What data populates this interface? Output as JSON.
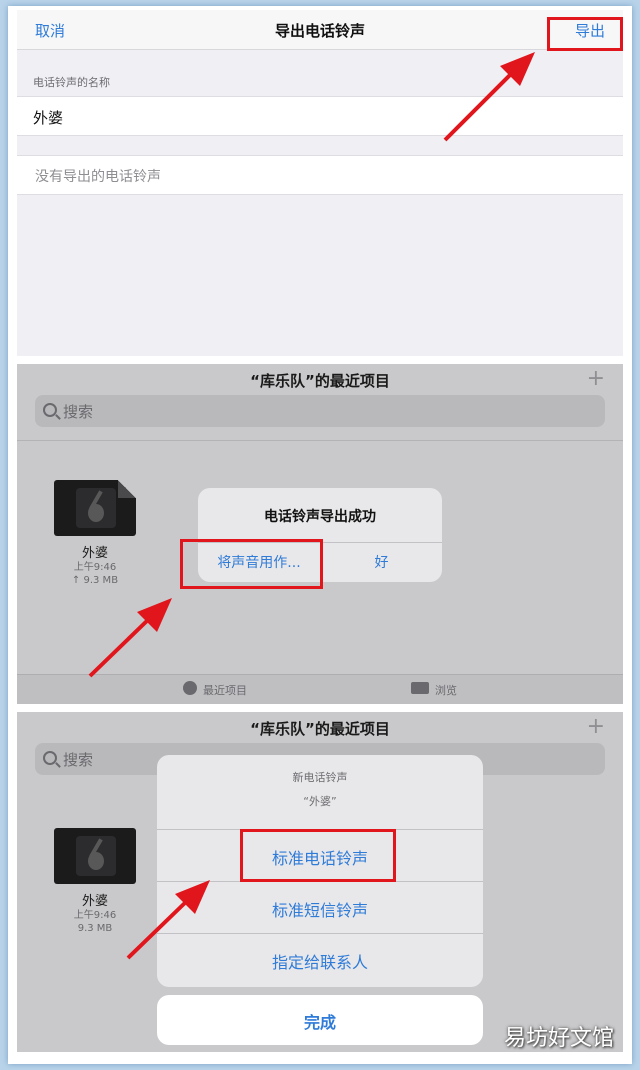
{
  "export_screen": {
    "cancel_label": "取消",
    "title": "导出电话铃声",
    "export_label": "导出",
    "section_label": "电话铃声的名称",
    "ringtone_name": "外婆",
    "no_exports_text": "没有导出的电话铃声"
  },
  "browser": {
    "title": "“库乐队”的最近项目",
    "plus_icon": "plus-icon",
    "search_placeholder": "搜索",
    "file": {
      "name": "外婆",
      "time": "上午9:46",
      "size_uploading": "↑ 9.3 MB",
      "size": "9.3 MB"
    },
    "tabs": [
      {
        "label": "最近项目",
        "icon": "clock-icon"
      },
      {
        "label": "浏览",
        "icon": "folder-icon"
      }
    ]
  },
  "alert": {
    "title": "电话铃声导出成功",
    "use_sound_as": "将声音用作...",
    "ok": "好"
  },
  "action_sheet": {
    "title": "新电话铃声",
    "subtitle": "“外婆”",
    "options": [
      "标准电话铃声",
      "标准短信铃声",
      "指定给联系人"
    ],
    "done": "完成"
  },
  "watermark": "易坊好文馆",
  "colors": {
    "accent": "#2f7bd8",
    "highlight": "#e0161c",
    "frame_bg": "#b9d4ea"
  }
}
